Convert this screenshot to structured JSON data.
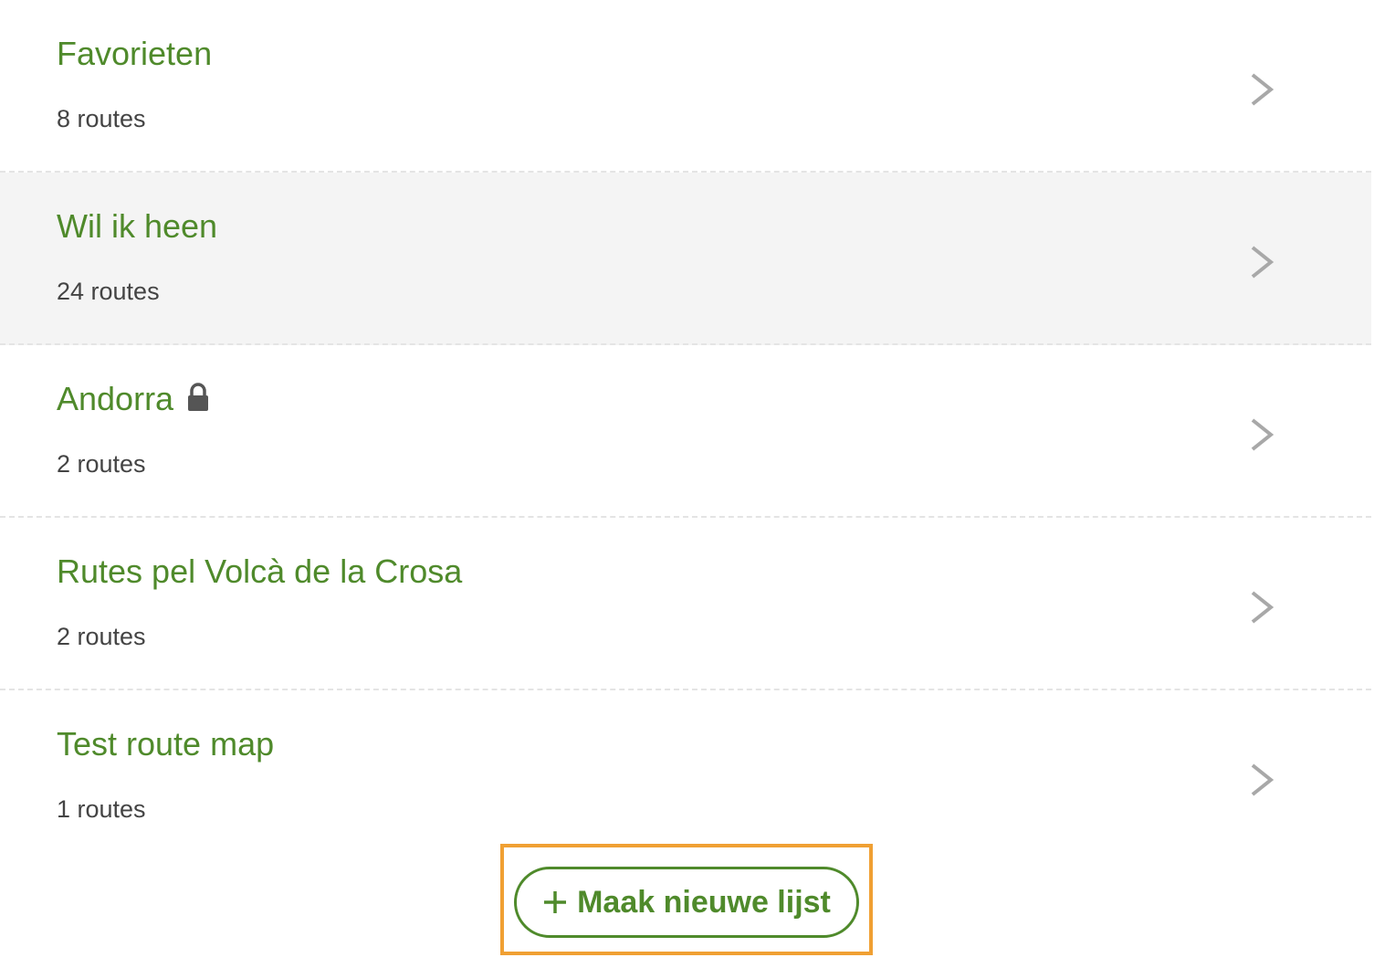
{
  "colors": {
    "accent": "#4f8a2b",
    "highlight_row": "#f4f4f4",
    "focus_outline": "#f0a033",
    "divider": "#e4e4e4",
    "count_text": "#444444",
    "chevron": "#a8a8a8"
  },
  "lists": [
    {
      "title": "Favorieten",
      "count": "8 routes",
      "locked": false
    },
    {
      "title": "Wil ik heen",
      "count": "24 routes",
      "locked": false
    },
    {
      "title": "Andorra",
      "count": "2 routes",
      "locked": true
    },
    {
      "title": "Rutes pel Volcà de la Crosa",
      "count": "2 routes",
      "locked": false
    },
    {
      "title": "Test route map",
      "count": "1 routes",
      "locked": false
    }
  ],
  "actions": {
    "new_list_label": "Maak nieuwe lijst"
  },
  "icons": {
    "chevron": "chevron-right-icon",
    "lock": "lock-icon",
    "plus": "plus-icon"
  }
}
